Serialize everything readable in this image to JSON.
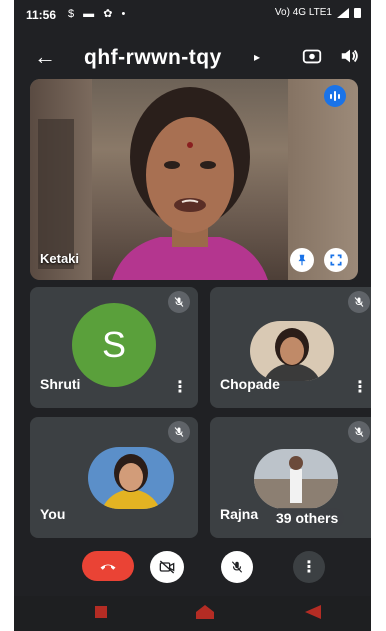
{
  "status_bar": {
    "time": "11:56",
    "notification_icons": [
      "dollar-icon",
      "message-icon",
      "chat-bubble-icon",
      "dot-icon"
    ],
    "signal_text": "Vo) 4G LTE1"
  },
  "top_bar": {
    "meeting_code": "qhf-rwwn-tqy"
  },
  "main_speaker": {
    "name": "Ketaki"
  },
  "participants": [
    {
      "name": "Shruti",
      "initial": "S",
      "avatar_color": "#5aa03b",
      "muted": true
    },
    {
      "name": "Chopade",
      "muted": true
    },
    {
      "name": "You",
      "muted": true
    },
    {
      "name": "Rajna",
      "muted": true,
      "others_label": "39 others"
    }
  ],
  "controls": {
    "end_call": "call-end-icon",
    "camera": "videocam-off-icon",
    "microphone": "mic-off-icon",
    "more": "more-vert-icon"
  },
  "colors": {
    "background": "#202124",
    "tile": "#3c4043",
    "end_call": "#ea4335",
    "accent": "#1a73e8"
  }
}
